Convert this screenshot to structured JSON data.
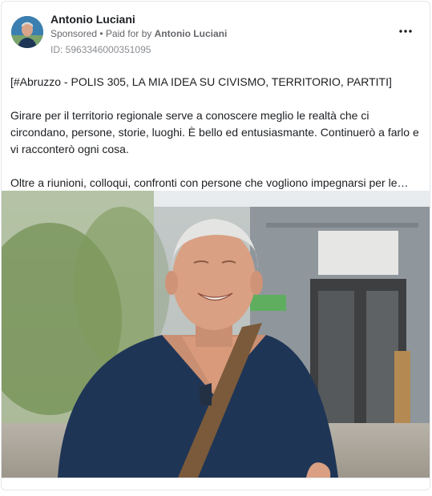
{
  "post": {
    "author": "Antonio Luciani",
    "sponsored": "Sponsored",
    "paid_for_prefix": "• Paid for by",
    "paid_for_name": "Antonio Luciani",
    "ad_id": "ID: 5963346000351095",
    "paragraphs": [
      "[#Abruzzo - POLIS 305, LA MIA IDEA SU CIVISMO, TERRITORIO, PARTITI]",
      "Girare per il territorio regionale serve a conoscere meglio le realtà che ci circondano, persone, storie, luoghi. È bello ed entusiasmante. Continuerò a farlo e vi racconterò ogni cosa.",
      "Oltre a riunioni, colloqui, confronti con persone che vogliono impegnarsi per le…"
    ]
  },
  "icons": {
    "more": "more-options-icon",
    "avatar": "avatar-photo"
  },
  "colors": {
    "text": "#1c1e21",
    "secondary": "#65676b",
    "border": "#e4e6eb",
    "shirt": "#1f3556"
  }
}
